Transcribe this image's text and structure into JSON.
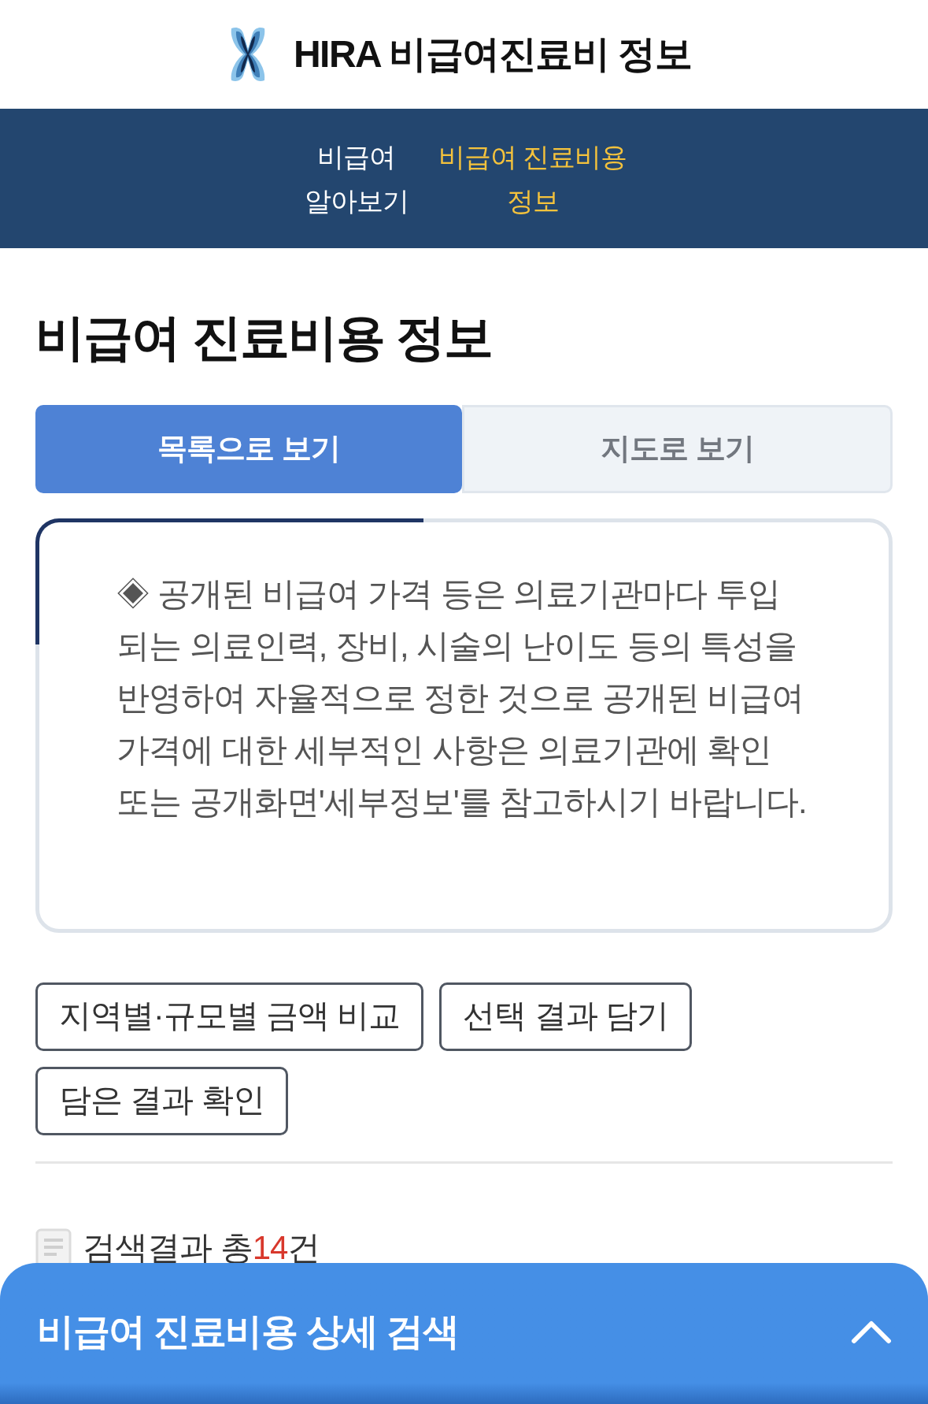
{
  "header": {
    "title": "HIRA 비급여진료비 정보"
  },
  "nav": {
    "items": [
      {
        "label": "비급여 알아보기",
        "selected": false
      },
      {
        "label": "비급여 진료비용 정보",
        "selected": true
      }
    ]
  },
  "page_title": "비급여 진료비용 정보",
  "view_tabs": [
    {
      "label": "목록으로 보기",
      "selected": true
    },
    {
      "label": "지도로 보기",
      "selected": false
    }
  ],
  "notice": {
    "text": "◈ 공개된 비급여 가격 등은 의료기관마다 투입되는 의료인력, 장비, 시술의 난이도 등의 특성을 반영하여 자율적으로 정한 것으로 공개된 비급여 가격에 대한 세부적인 사항은 의료기관에 확인 또는 공개화면'세부정보'를 참고하시기 바랍니다."
  },
  "actions": [
    "지역별·규모별 금액 비교",
    "선택 결과 담기",
    "담은 결과 확인"
  ],
  "results": {
    "label": "검색결과 총",
    "count": "14",
    "unit": "건"
  },
  "search_sheet": {
    "title": "비급여 진료비용 상세 검색",
    "expanded": false
  }
}
